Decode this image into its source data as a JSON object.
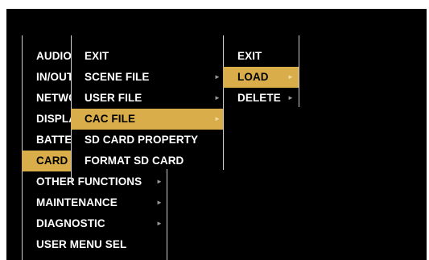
{
  "root_menu": {
    "items": [
      {
        "label": "AUDIO",
        "has_sub": false
      },
      {
        "label": "IN/OUT",
        "has_sub": false
      },
      {
        "label": "NETWORK",
        "has_sub": false
      },
      {
        "label": "DISPLAY",
        "has_sub": false
      },
      {
        "label": "BATTERY",
        "has_sub": false
      },
      {
        "label": "CARD",
        "has_sub": false,
        "selected": true
      },
      {
        "label": "OTHER FUNCTIONS",
        "has_sub": true
      },
      {
        "label": "MAINTENANCE",
        "has_sub": true
      },
      {
        "label": "DIAGNOSTIC",
        "has_sub": true
      },
      {
        "label": "USER MENU SEL",
        "has_sub": false
      }
    ]
  },
  "card_menu": {
    "items": [
      {
        "label": "EXIT",
        "has_sub": false
      },
      {
        "label": "SCENE FILE",
        "has_sub": true
      },
      {
        "label": "USER FILE",
        "has_sub": true
      },
      {
        "label": "CAC FILE",
        "has_sub": true,
        "selected": true
      },
      {
        "label": "SD CARD PROPERTY",
        "has_sub": false
      },
      {
        "label": "FORMAT SD CARD",
        "has_sub": false
      }
    ]
  },
  "cac_menu": {
    "items": [
      {
        "label": "EXIT",
        "has_sub": false
      },
      {
        "label": "LOAD",
        "has_sub": true,
        "selected": true
      },
      {
        "label": "DELETE",
        "has_sub": true
      }
    ]
  },
  "arrow_glyph": "►",
  "colors": {
    "background": "#000000",
    "highlight": "#d8ad4a",
    "text": "#ffffff",
    "divider": "#cfcfcf"
  }
}
